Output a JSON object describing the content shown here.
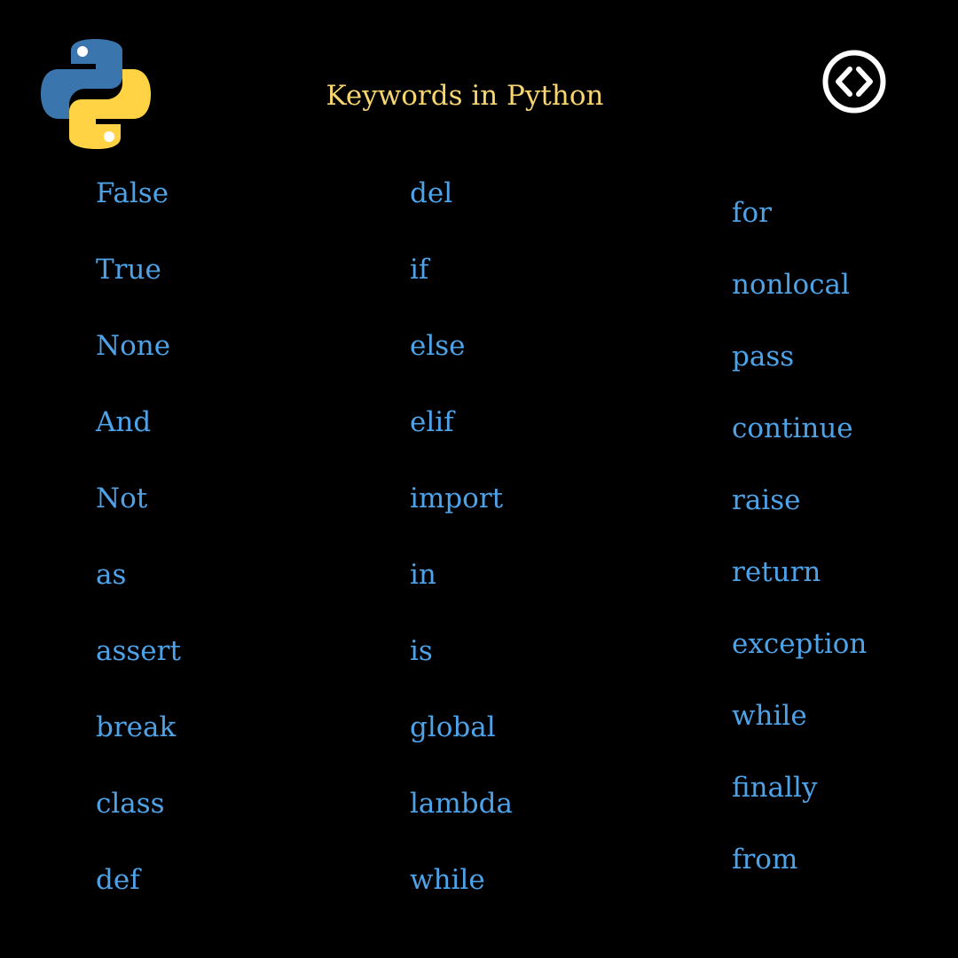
{
  "header": {
    "title": "Keywords in Python",
    "logo_icon": "python-logo-icon",
    "code_icon": "code-brackets-icon"
  },
  "colors": {
    "background": "#000000",
    "title": "#f8d66f",
    "keyword": "#4ea3e8",
    "logo_blue": "#3a75ae",
    "logo_yellow": "#ffd343",
    "icon": "#ffffff"
  },
  "columns": [
    [
      "False",
      "True",
      "None",
      "And",
      "Not",
      "as",
      "assert",
      "break",
      "class",
      "def"
    ],
    [
      "del",
      "if",
      "else",
      "elif",
      "import",
      "in",
      "is",
      "global",
      "lambda",
      "while"
    ],
    [
      "for",
      "nonlocal",
      "pass",
      "continue",
      "raise",
      "return",
      "exception",
      "while",
      "finally",
      "from"
    ]
  ]
}
